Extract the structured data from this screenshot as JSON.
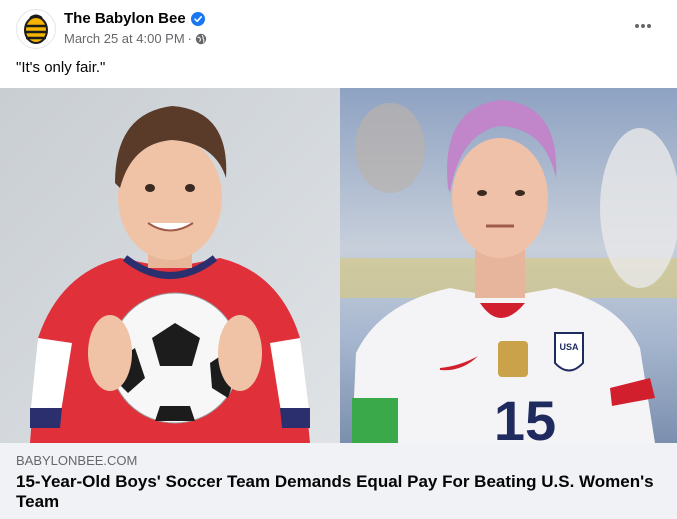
{
  "post": {
    "page_name": "The Babylon Bee",
    "timestamp": "March 25 at 4:00 PM",
    "meta_separator": "·",
    "caption": "\"It's only fair.\"",
    "icons": {
      "avatar": "bee-logo-icon",
      "verified": "verified-badge-icon",
      "audience": "globe-icon",
      "more": "more-options-icon"
    }
  },
  "link_preview": {
    "domain": "BABYLONBEE.COM",
    "headline": "15-Year-Old Boys' Soccer Team Demands Equal Pay For Beating U.S. Women's Team",
    "jersey_number": "15",
    "badge_text": "USA"
  },
  "colors": {
    "verified_blue": "#1877f2",
    "link_bg": "#f0f2f5",
    "meta_gray": "#65676b",
    "bee_yellow": "#f5b400"
  }
}
